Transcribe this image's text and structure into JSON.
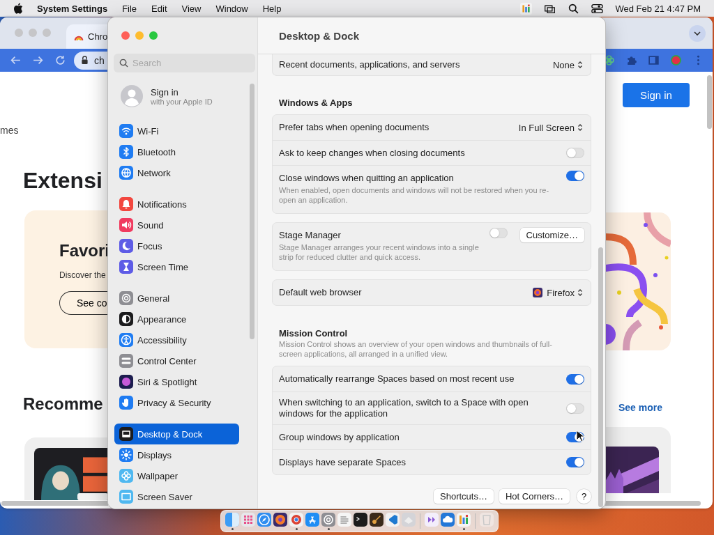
{
  "menubar": {
    "app": "System Settings",
    "menus": [
      "File",
      "Edit",
      "View",
      "Window",
      "Help"
    ],
    "clock": "Wed Feb 21 4:47 PM"
  },
  "browser": {
    "tab": {
      "title": "Chro"
    },
    "address": "ch",
    "nav_text": "mes",
    "heading": "Extensi",
    "card": {
      "title": "Favori",
      "text": "Discover the",
      "button": "See co"
    },
    "section_title": "Recomme",
    "sign_in": "Sign in",
    "see_more": "See more"
  },
  "settings": {
    "title": "Desktop & Dock",
    "sidebar": {
      "search": {
        "placeholder": "Search"
      },
      "account": {
        "title": "Sign in",
        "subtitle": "with your Apple ID"
      },
      "groups": [
        {
          "items": [
            {
              "label": "Wi-Fi",
              "selected": false
            },
            {
              "label": "Bluetooth",
              "selected": false
            },
            {
              "label": "Network",
              "selected": false
            }
          ]
        },
        {
          "items": [
            {
              "label": "Notifications",
              "selected": false
            },
            {
              "label": "Sound",
              "selected": false
            },
            {
              "label": "Focus",
              "selected": false
            },
            {
              "label": "Screen Time",
              "selected": false
            }
          ]
        },
        {
          "items": [
            {
              "label": "General",
              "selected": false
            },
            {
              "label": "Appearance",
              "selected": false
            },
            {
              "label": "Accessibility",
              "selected": false
            },
            {
              "label": "Control Center",
              "selected": false
            },
            {
              "label": "Siri & Spotlight",
              "selected": false
            },
            {
              "label": "Privacy & Security",
              "selected": false
            }
          ]
        },
        {
          "items": [
            {
              "label": "Desktop & Dock",
              "selected": true
            },
            {
              "label": "Displays",
              "selected": false
            },
            {
              "label": "Wallpaper",
              "selected": false
            },
            {
              "label": "Screen Saver",
              "selected": false
            }
          ]
        }
      ]
    },
    "blocks": [
      {
        "kind": "card",
        "rows": [
          {
            "kind": "popup",
            "label": "Recent documents, applications, and servers",
            "value": "None"
          }
        ]
      },
      {
        "kind": "heading",
        "title": "Windows & Apps"
      },
      {
        "kind": "card",
        "rows": [
          {
            "kind": "popup",
            "label": "Prefer tabs when opening documents",
            "value": "In Full Screen"
          },
          {
            "kind": "toggle",
            "label": "Ask to keep changes when closing documents",
            "on": false
          },
          {
            "kind": "toggle",
            "label": "Close windows when quitting an application",
            "description": "When enabled, open documents and windows will not be restored when you re-open an application.",
            "on": true
          }
        ]
      },
      {
        "kind": "card",
        "rows": [
          {
            "kind": "toggle",
            "label": "Stage Manager",
            "description": "Stage Manager arranges your recent windows into a single strip for reduced clutter and quick access.",
            "on": false,
            "button": "Customize…"
          }
        ]
      },
      {
        "kind": "card",
        "rows": [
          {
            "kind": "app_popup",
            "label": "Default web browser",
            "value": "Firefox"
          }
        ]
      },
      {
        "kind": "heading",
        "title": "Mission Control",
        "description": "Mission Control shows an overview of your open windows and thumbnails of full-screen applications, all arranged in a unified view."
      },
      {
        "kind": "card",
        "rows": [
          {
            "kind": "toggle",
            "label": "Automatically rearrange Spaces based on most recent use",
            "on": true
          },
          {
            "kind": "toggle",
            "label": "When switching to an application, switch to a Space with open windows for the application",
            "on": false
          },
          {
            "kind": "toggle",
            "label": "Group windows by application",
            "on": true
          },
          {
            "kind": "toggle",
            "label": "Displays have separate Spaces",
            "on": true
          }
        ]
      }
    ],
    "buttons": [
      {
        "kind": "text",
        "label": "Shortcuts…"
      },
      {
        "kind": "text",
        "label": "Hot Corners…"
      },
      {
        "kind": "help",
        "label": "?"
      }
    ]
  },
  "dock": {
    "items": [
      {
        "running": true
      },
      {
        "running": false
      },
      {
        "running": false
      },
      {
        "running": false
      },
      {
        "running": true
      },
      {
        "running": false
      },
      {
        "running": true
      },
      {
        "running": false
      },
      {
        "running": false
      },
      {
        "running": false
      },
      {
        "running": false
      },
      {
        "running": false
      },
      {
        "running": false
      },
      {
        "running": false
      },
      {
        "running": true
      },
      {
        "running": false
      }
    ]
  }
}
